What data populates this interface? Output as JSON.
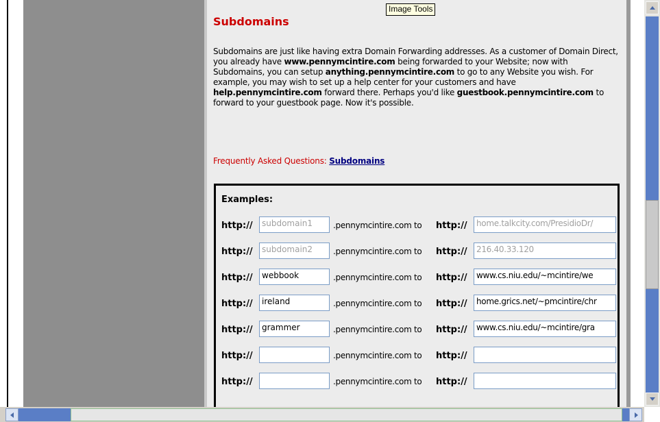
{
  "tooltip": "Image Tools",
  "section": {
    "title": "Subdomains",
    "para_1": "Subdomains are just like having extra Domain Forwarding addresses. As a customer of Domain Direct, you already have ",
    "bold_1": "www.pennymcintire.com",
    "para_2": " being forwarded to your Website; now with Subdomains, you can setup ",
    "bold_2": "anything.pennymcintire.com",
    "para_3": " to go to any Website you wish. For example, you may wish to set up a help center for your customers and have ",
    "bold_3": "help.pennymcintire.com",
    "para_4": " forward there. Perhaps you'd like ",
    "bold_4": "guestbook.pennymcintire.com",
    "para_5": " to forward to your guestbook page. Now it's possible.",
    "faq_label": "Frequently Asked Questions: ",
    "faq_link": "Subdomains"
  },
  "examples": {
    "title": "Examples:",
    "http_label": "http://",
    "domain_suffix": ".pennymcintire.com to",
    "rows": [
      {
        "sub": "subdomain1",
        "dest": "home.talkcity.com/PresidioDr/",
        "sub_placeholder": true,
        "dest_placeholder": true
      },
      {
        "sub": "subdomain2",
        "dest": "216.40.33.120",
        "sub_placeholder": true,
        "dest_placeholder": true
      },
      {
        "sub": "webbook",
        "dest": "www.cs.niu.edu/~mcintire/we",
        "sub_placeholder": false,
        "dest_placeholder": false
      },
      {
        "sub": "ireland",
        "dest": "home.grics.net/~pmcintire/chr",
        "sub_placeholder": false,
        "dest_placeholder": false
      },
      {
        "sub": "grammer",
        "dest": "www.cs.niu.edu/~mcintire/gra",
        "sub_placeholder": false,
        "dest_placeholder": false
      },
      {
        "sub": "",
        "dest": "",
        "sub_placeholder": false,
        "dest_placeholder": false
      },
      {
        "sub": "",
        "dest": "",
        "sub_placeholder": false,
        "dest_placeholder": false
      }
    ]
  },
  "colors": {
    "title_red": "#cc0000",
    "link_blue": "#000080",
    "scroll_blue": "#5a7ec6"
  }
}
